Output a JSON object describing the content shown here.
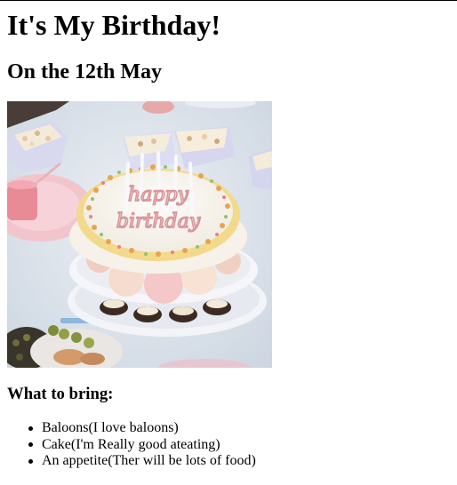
{
  "heading": "It's My Birthday!",
  "subheading": "On the 12th May",
  "image": {
    "alt": "Birthday cake with candles",
    "cake_text": "happy birthday"
  },
  "bring_section": {
    "title": "What to bring:",
    "items": [
      "Baloons(I love baloons)",
      "Cake(I'm Really good ateating)",
      "An appetite(Ther will be lots of food)"
    ]
  }
}
